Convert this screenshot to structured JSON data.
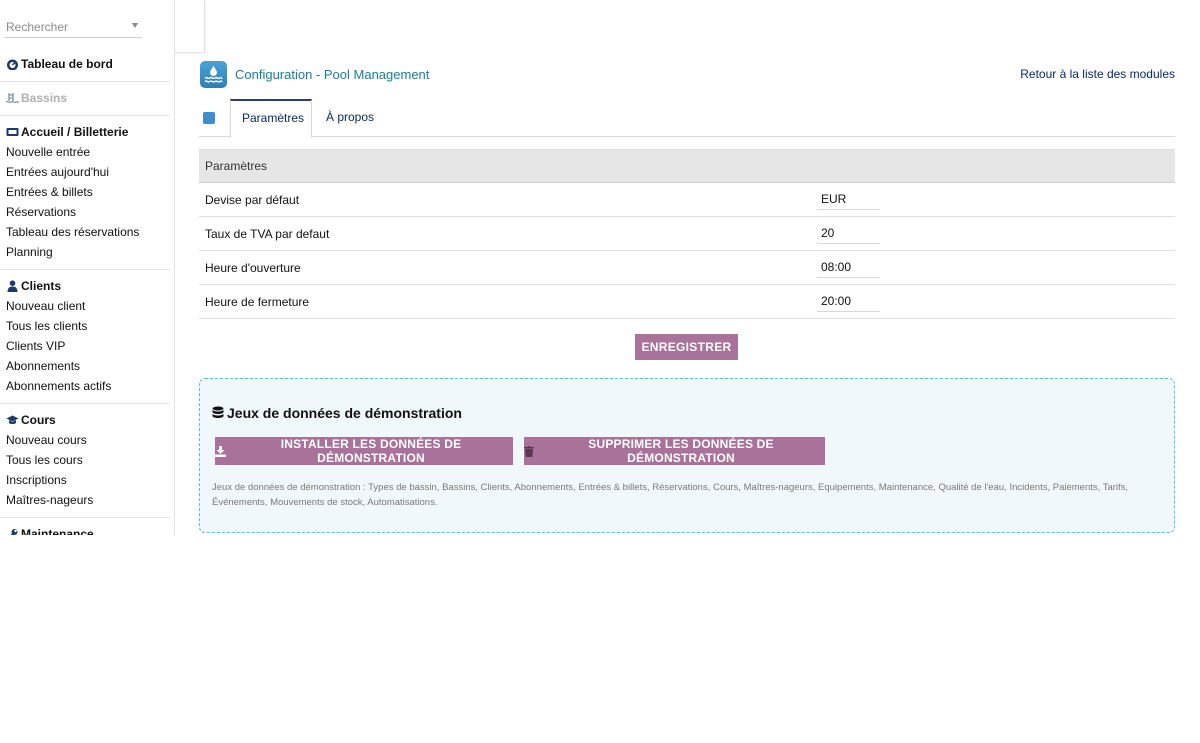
{
  "sidebar": {
    "search_placeholder": "Rechercher",
    "sections": [
      {
        "title": "Tableau de bord",
        "icon": "dashboard-icon",
        "items": []
      },
      {
        "title": "Bassins",
        "icon": "pool-icon",
        "disabled": true,
        "items": []
      },
      {
        "title": "Accueil / Billetterie",
        "icon": "ticket-icon",
        "items": [
          "Nouvelle entrée",
          "Entrées aujourd'hui",
          "Entrées & billets",
          "Réservations",
          "Tableau des réservations",
          "Planning"
        ]
      },
      {
        "title": "Clients",
        "icon": "user-icon",
        "items": [
          "Nouveau client",
          "Tous les clients",
          "Clients VIP",
          "Abonnements",
          "Abonnements actifs"
        ]
      },
      {
        "title": "Cours",
        "icon": "graduation-cap-icon",
        "items": [
          "Nouveau cours",
          "Tous les cours",
          "Inscriptions",
          "Maîtres-nageurs"
        ]
      },
      {
        "title": "Maintenance",
        "icon": "wrench-icon",
        "items": []
      }
    ]
  },
  "header": {
    "title": "Configuration - Pool Management",
    "back_link": "Retour à la liste des modules"
  },
  "tabs": [
    {
      "label": "Paramètres",
      "active": true
    },
    {
      "label": "À propos",
      "active": false
    }
  ],
  "settings": {
    "header": "Paramètres",
    "rows": [
      {
        "label": "Devise par défaut",
        "value": "EUR"
      },
      {
        "label": "Taux de TVA par defaut",
        "value": "20"
      },
      {
        "label": "Heure d'ouverture",
        "value": "08:00"
      },
      {
        "label": "Heure de fermeture",
        "value": "20:00"
      }
    ],
    "save_label": "ENREGISTRER"
  },
  "demo": {
    "title": "Jeux de données de démonstration",
    "install_label": "INSTALLER LES DONNÉES DE DÉMONSTRATION",
    "delete_label": "SUPPRIMER LES DONNÉES DE DÉMONSTRATION",
    "description": "Jeux de données de démonstration : Types de bassin, Bassins, Clients, Abonnements, Entrées & billets, Réservations, Cours, Maîtres-nageurs, Equipements, Maintenance, Qualité de l'eau, Incidents, Paiements, Tarifs, Événements, Mouvements de stock, Automatisations."
  },
  "colors": {
    "accent": "#a8729a",
    "title": "#1e7d99",
    "link": "#0a2a66",
    "demo_border": "#56c3d4",
    "demo_bg": "#f0f8fb"
  }
}
